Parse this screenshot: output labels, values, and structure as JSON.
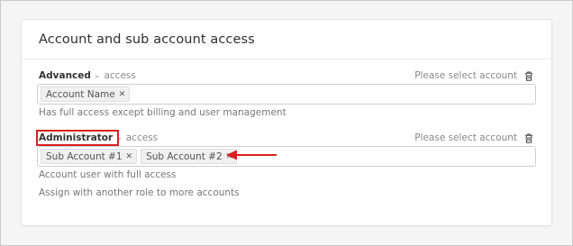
{
  "card": {
    "title": "Account and sub account access"
  },
  "roles": [
    {
      "name": "Advanced",
      "access_word": "access",
      "select_text": "Please select account",
      "tags": [
        "Account Name"
      ],
      "descriptions": [
        "Has full access except billing and user management"
      ]
    },
    {
      "name": "Administrator",
      "access_word": "access",
      "select_text": "Please select account",
      "tags": [
        "Sub Account #1",
        "Sub Account #2"
      ],
      "descriptions": [
        "Account user with full access",
        "Assign with another role to more accounts"
      ]
    }
  ],
  "icons": {
    "chevron": "chevron-down-icon",
    "trash": "trash-icon",
    "tag_remove": "close-icon"
  },
  "colors": {
    "annotation": "#d62020"
  }
}
